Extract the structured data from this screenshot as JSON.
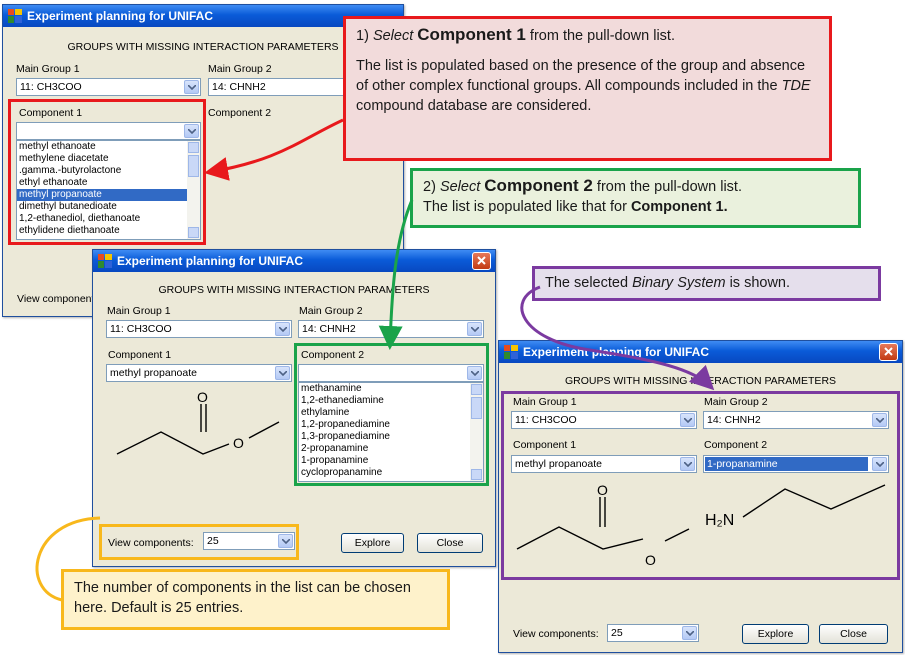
{
  "window_title": "Experiment planning for UNIFAC",
  "heading": "GROUPS WITH MISSING INTERACTION PARAMETERS",
  "labels": {
    "main_group_1": "Main Group 1",
    "main_group_2": "Main Group 2",
    "component_1": "Component 1",
    "component_2": "Component 2",
    "view_components": "View components:",
    "view_components_short": "View component"
  },
  "values": {
    "main_group_1": "11: CH3COO",
    "main_group_2": "14: CHNH2",
    "component_1": "methyl propanoate",
    "component_2": "1-propanamine",
    "view_components": "25"
  },
  "buttons": {
    "explore": "Explore",
    "close": "Close"
  },
  "component1_list": [
    "methyl ethanoate",
    "methylene diacetate",
    ".gamma.-butyrolactone",
    "ethyl ethanoate",
    "methyl propanoate",
    "dimethyl butanedioate",
    "1,2-ethanediol, diethanoate",
    "ethylidene diethanoate"
  ],
  "component1_selected_index": 4,
  "component2_list": [
    "methanamine",
    "1,2-ethanediamine",
    "ethylamine",
    "1,2-propanediamine",
    "1,3-propanediamine",
    "2-propanamine",
    "1-propanamine",
    "cyclopropanamine"
  ],
  "structure_labels": {
    "oxygen": "O",
    "amine": "H₂N"
  },
  "callouts": {
    "c1": {
      "step": "1)",
      "verb": "Select",
      "target": "Component 1",
      "rest": "from the pull-down list.",
      "body_a": "The list is populated based on the presence of the group and absence  of other complex functional groups. All compounds included in the",
      "body_em": "TDE",
      "body_b": "compound database are considered."
    },
    "c2": {
      "step": "2)",
      "verb": "Select",
      "target": "Component 2",
      "rest": "from the pull-down list.",
      "line2": "The list is populated like that for",
      "line2_bold": "Component 1."
    },
    "c3": {
      "pre": "The selected",
      "em": "Binary System",
      "post": "is shown."
    },
    "c4": {
      "text": "The number of components in the list can be chosen here. Default is 25 entries."
    }
  },
  "colors": {
    "red": "#e8191c",
    "green": "#1aa34a",
    "purple": "#7b3aa0",
    "orange": "#f8b81c",
    "callout1_bg": "#f2dbdb",
    "callout2_bg": "#eaf1dd",
    "callout3_bg": "#e5dfec",
    "callout4_bg": "#fef2cb"
  }
}
